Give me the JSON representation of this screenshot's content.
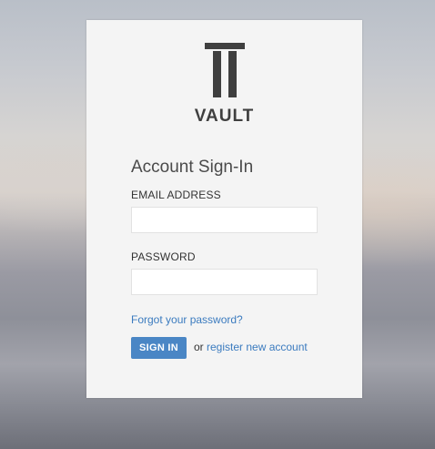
{
  "brand": {
    "name": "VAULT",
    "logo_icon": "vault-pillars-logo",
    "logo_color": "#3f3f3f"
  },
  "form": {
    "title": "Account Sign-In",
    "email": {
      "label": "EMAIL ADDRESS",
      "value": "",
      "placeholder": ""
    },
    "password": {
      "label": "PASSWORD",
      "value": "",
      "placeholder": ""
    },
    "forgot_link": "Forgot your password?",
    "signin_button": "SIGN IN",
    "or_text": "or",
    "register_link": "register new account"
  },
  "colors": {
    "accent": "#4a86c5",
    "link": "#3b7bbf",
    "card_background": "#f4f4f4"
  }
}
